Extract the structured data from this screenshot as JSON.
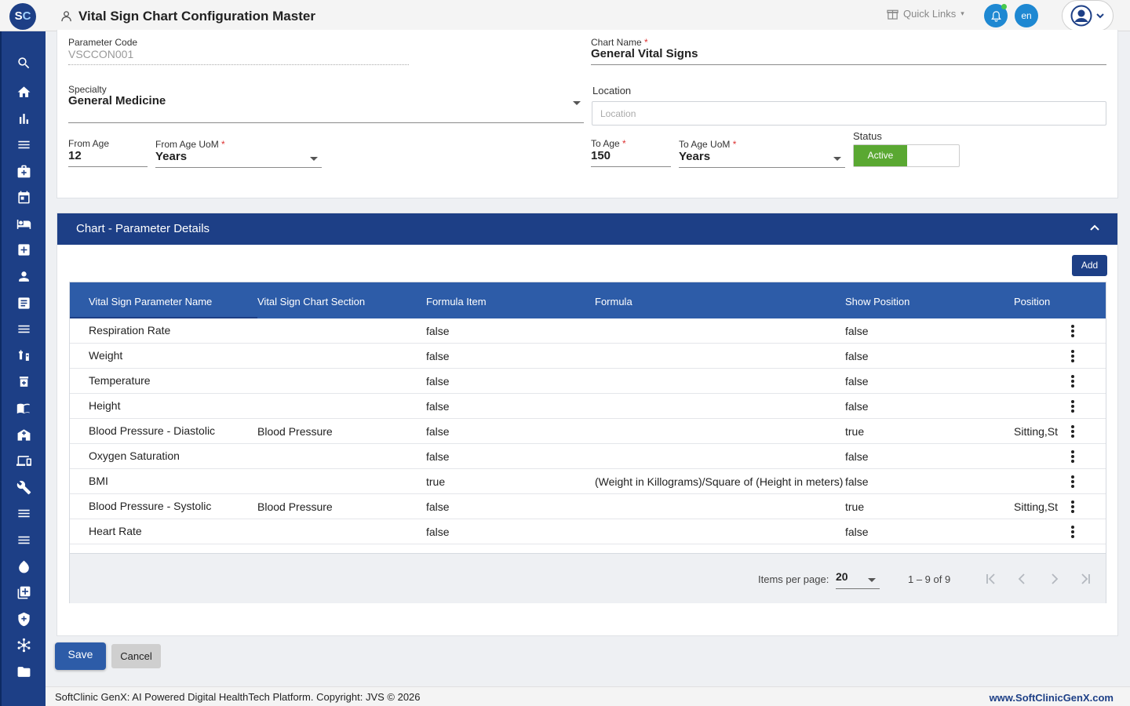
{
  "header": {
    "logo_s": "S",
    "logo_c": "C",
    "title": "Vital Sign Chart Configuration Master",
    "quick_links": "Quick Links",
    "lang": "en"
  },
  "form": {
    "parameter_code_label": "Parameter Code",
    "parameter_code_value": "VSCCON001",
    "chart_name_label": "Chart Name",
    "chart_name_value": "General Vital Signs",
    "specialty_label": "Specialty",
    "specialty_value": "General Medicine",
    "location_label": "Location",
    "location_placeholder": "Location",
    "from_age_label": "From Age",
    "from_age_value": "12",
    "from_age_uom_label": "From Age UoM",
    "from_age_uom_value": "Years",
    "to_age_label": "To Age",
    "to_age_value": "150",
    "to_age_uom_label": "To Age UoM",
    "to_age_uom_value": "Years",
    "status_label": "Status",
    "status_value": "Active",
    "required_mark": "*"
  },
  "details": {
    "title": "Chart - Parameter Details",
    "add_label": "Add",
    "columns": [
      "Vital Sign Parameter Name",
      "Vital Sign Chart Section",
      "Formula Item",
      "Formula",
      "Show Position",
      "Position"
    ],
    "rows": [
      {
        "name": "Respiration Rate",
        "section": "",
        "formula_item": "false",
        "formula": "",
        "show_position": "false",
        "position": ""
      },
      {
        "name": "Weight",
        "section": "",
        "formula_item": "false",
        "formula": "",
        "show_position": "false",
        "position": ""
      },
      {
        "name": "Temperature",
        "section": "",
        "formula_item": "false",
        "formula": "",
        "show_position": "false",
        "position": ""
      },
      {
        "name": "Height",
        "section": "",
        "formula_item": "false",
        "formula": "",
        "show_position": "false",
        "position": ""
      },
      {
        "name": "Blood Pressure - Diastolic",
        "section": "Blood Pressure",
        "formula_item": "false",
        "formula": "",
        "show_position": "true",
        "position": "Sitting,St"
      },
      {
        "name": "Oxygen Saturation",
        "section": "",
        "formula_item": "false",
        "formula": "",
        "show_position": "false",
        "position": ""
      },
      {
        "name": "BMI",
        "section": "",
        "formula_item": "true",
        "formula": "(Weight in Killograms)/Square of (Height in meters)",
        "show_position": "false",
        "position": ""
      },
      {
        "name": "Blood Pressure - Systolic",
        "section": "Blood Pressure",
        "formula_item": "false",
        "formula": "",
        "show_position": "true",
        "position": "Sitting,St"
      },
      {
        "name": "Heart Rate",
        "section": "",
        "formula_item": "false",
        "formula": "",
        "show_position": "false",
        "position": ""
      }
    ],
    "paginator": {
      "items_per_page_label": "Items per page:",
      "page_size": "20",
      "range": "1 – 9 of 9"
    }
  },
  "actions": {
    "save_label": "Save",
    "cancel_label": "Cancel"
  },
  "footer": {
    "copyright": "SoftClinic GenX: AI Powered Digital HealthTech Platform. Copyright: JVS © 2026",
    "website": "www.SoftClinicGenX.com"
  },
  "sidebar_icons": [
    "search-icon",
    "home-icon",
    "bar-chart-icon",
    "menu-icon",
    "medical-bag-icon",
    "calendar-icon",
    "bed-icon",
    "plus-box-icon",
    "person-icon",
    "list-alt-icon",
    "menu-icon",
    "syringe-icon",
    "pill-box-icon",
    "book-icon",
    "hospital-building-icon",
    "devices-icon",
    "wrench-icon",
    "menu-icon",
    "menu-icon",
    "blood-drop-icon",
    "library-add-icon",
    "shield-plus-icon",
    "hub-icon",
    "folder-icon"
  ],
  "colors": {
    "brand": "#1d3f86",
    "table_header": "#2d5ca8",
    "status_active": "#5aa832",
    "notification": "#1e88d2"
  }
}
